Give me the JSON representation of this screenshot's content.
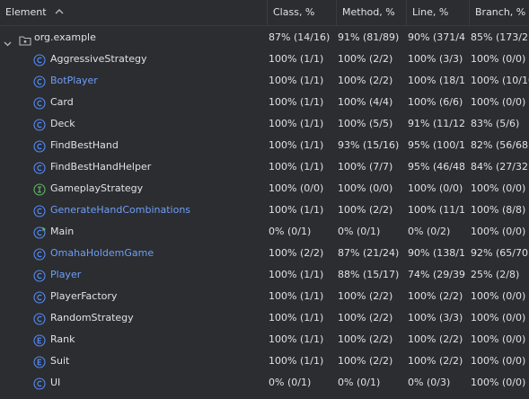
{
  "header": {
    "element": "Element",
    "class": "Class, %",
    "method": "Method, %",
    "line": "Line, %",
    "branch": "Branch, %"
  },
  "package": {
    "name": "org.example",
    "class": "87% (14/16)",
    "method": "91% (81/89)",
    "line": "90% (371/4...",
    "branch": "85% (173/2..."
  },
  "rows": [
    {
      "name": "AggressiveStrategy",
      "icon": "class-icon",
      "color": "#dfe1e5",
      "class": "100% (1/1)",
      "method": "100% (2/2)",
      "line": "100% (3/3)",
      "branch": "100% (0/0)"
    },
    {
      "name": "BotPlayer",
      "icon": "class-icon",
      "color": "#6f9ff7",
      "class": "100% (1/1)",
      "method": "100% (2/2)",
      "line": "100% (18/18)",
      "branch": "100% (10/10)"
    },
    {
      "name": "Card",
      "icon": "class-icon",
      "color": "#dfe1e5",
      "class": "100% (1/1)",
      "method": "100% (4/4)",
      "line": "100% (6/6)",
      "branch": "100% (0/0)"
    },
    {
      "name": "Deck",
      "icon": "class-icon",
      "color": "#dfe1e5",
      "class": "100% (1/1)",
      "method": "100% (5/5)",
      "line": "91% (11/12)",
      "branch": "83% (5/6)"
    },
    {
      "name": "FindBestHand",
      "icon": "class-icon",
      "color": "#dfe1e5",
      "class": "100% (1/1)",
      "method": "93% (15/16)",
      "line": "95% (100/1...",
      "branch": "82% (56/68)"
    },
    {
      "name": "FindBestHandHelper",
      "icon": "class-icon",
      "color": "#dfe1e5",
      "class": "100% (1/1)",
      "method": "100% (7/7)",
      "line": "95% (46/48)",
      "branch": "84% (27/32)"
    },
    {
      "name": "GameplayStrategy",
      "icon": "interface-icon",
      "color": "#dfe1e5",
      "class": "100% (0/0)",
      "method": "100% (0/0)",
      "line": "100% (0/0)",
      "branch": "100% (0/0)"
    },
    {
      "name": "GenerateHandCombinations",
      "icon": "class-icon",
      "color": "#6f9ff7",
      "class": "100% (1/1)",
      "method": "100% (2/2)",
      "line": "100% (11/11)",
      "branch": "100% (8/8)"
    },
    {
      "name": "Main",
      "icon": "main-class-icon",
      "color": "#dfe1e5",
      "class": "0% (0/1)",
      "method": "0% (0/1)",
      "line": "0% (0/2)",
      "branch": "100% (0/0)"
    },
    {
      "name": "OmahaHoldemGame",
      "icon": "class-icon",
      "color": "#6f9ff7",
      "class": "100% (2/2)",
      "method": "87% (21/24)",
      "line": "90% (138/1...",
      "branch": "92% (65/70)"
    },
    {
      "name": "Player",
      "icon": "class-icon",
      "color": "#6f9ff7",
      "class": "100% (1/1)",
      "method": "88% (15/17)",
      "line": "74% (29/39)",
      "branch": "25% (2/8)"
    },
    {
      "name": "PlayerFactory",
      "icon": "class-icon",
      "color": "#dfe1e5",
      "class": "100% (1/1)",
      "method": "100% (2/2)",
      "line": "100% (2/2)",
      "branch": "100% (0/0)"
    },
    {
      "name": "RandomStrategy",
      "icon": "class-icon",
      "color": "#dfe1e5",
      "class": "100% (1/1)",
      "method": "100% (2/2)",
      "line": "100% (3/3)",
      "branch": "100% (0/0)"
    },
    {
      "name": "Rank",
      "icon": "enum-icon",
      "color": "#dfe1e5",
      "class": "100% (1/1)",
      "method": "100% (2/2)",
      "line": "100% (2/2)",
      "branch": "100% (0/0)"
    },
    {
      "name": "Suit",
      "icon": "enum-icon",
      "color": "#dfe1e5",
      "class": "100% (1/1)",
      "method": "100% (2/2)",
      "line": "100% (2/2)",
      "branch": "100% (0/0)"
    },
    {
      "name": "UI",
      "icon": "class-icon",
      "color": "#dfe1e5",
      "class": "0% (0/1)",
      "method": "0% (0/1)",
      "line": "0% (0/3)",
      "branch": "100% (0/0)"
    }
  ]
}
